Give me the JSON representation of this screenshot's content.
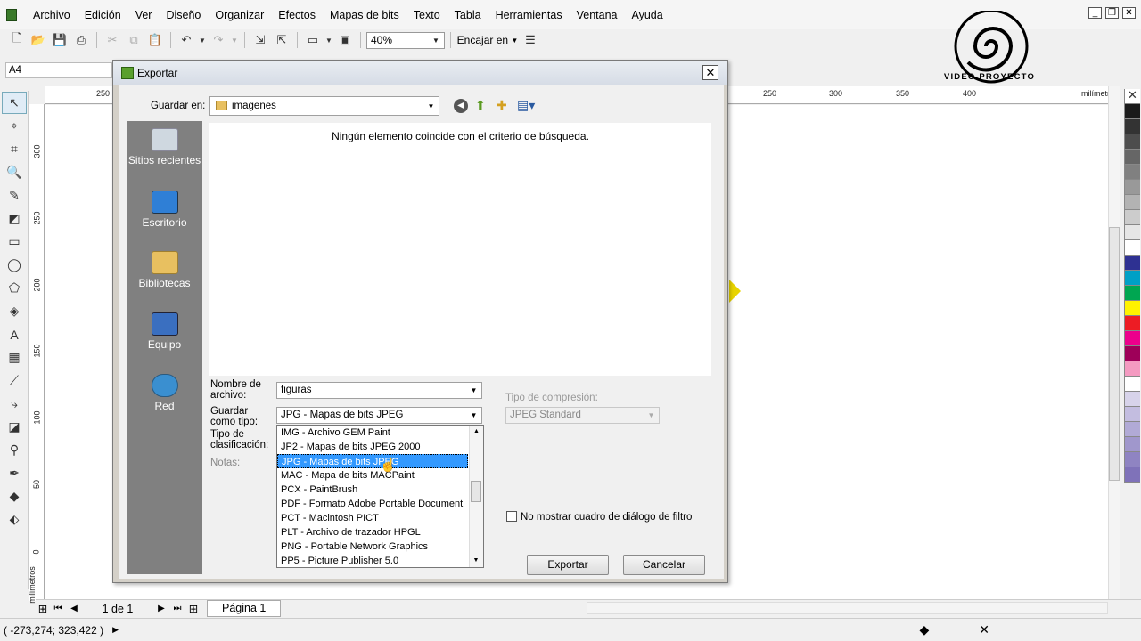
{
  "menu": [
    "Archivo",
    "Edición",
    "Ver",
    "Diseño",
    "Organizar",
    "Efectos",
    "Mapas de bits",
    "Texto",
    "Tabla",
    "Herramientas",
    "Ventana",
    "Ayuda"
  ],
  "toolbar": {
    "zoom": "40%",
    "snap": "Encajar en"
  },
  "property_bar": {
    "page_size": "A4"
  },
  "rulers": {
    "top": [
      "250",
      "250",
      "300",
      "350",
      "400"
    ],
    "top_unit": "milímetros",
    "left": [
      "300",
      "250",
      "200",
      "150",
      "100",
      "50",
      "0"
    ],
    "left_unit": "milímetros"
  },
  "logo": {
    "text": "Video Proyecto"
  },
  "palette": [
    "none",
    "#1a1a1a",
    "#333333",
    "#4d4d4d",
    "#666666",
    "#808080",
    "#999999",
    "#b3b3b3",
    "#cccccc",
    "#e6e6e6",
    "#ffffff",
    "#2e3192",
    "#00a0c6",
    "#00a651",
    "#fff200",
    "#ed1c24",
    "#ec008c",
    "#9e0059",
    "#f49ac1",
    "#ffffff",
    "#d7d3ea",
    "#c3bde0",
    "#b1aad6",
    "#a097cc",
    "#8f84c2",
    "#7f72b9"
  ],
  "page_nav": {
    "count": "1 de 1",
    "page_tab": "Página 1"
  },
  "status": {
    "coords": "( -273,274; 323,422 )"
  },
  "dialog": {
    "title": "Exportar",
    "save_in_label": "Guardar en:",
    "save_in_value": "imagenes",
    "places": [
      {
        "label": "Sitios recientes",
        "icon": "recent-places-icon"
      },
      {
        "label": "Escritorio",
        "icon": "desktop-icon"
      },
      {
        "label": "Bibliotecas",
        "icon": "libraries-icon"
      },
      {
        "label": "Equipo",
        "icon": "computer-icon"
      },
      {
        "label": "Red",
        "icon": "network-icon"
      }
    ],
    "empty_message": "Ningún elemento coincide con el criterio de búsqueda.",
    "filename_label": "Nombre de archivo:",
    "filename_value": "figuras",
    "type_label": "Guardar como tipo:",
    "type_value": "JPG - Mapas de bits JPEG",
    "sort_label": "Tipo de clasificación:",
    "notes_label": "Notas:",
    "compression_label": "Tipo de compresión:",
    "compression_value": "JPEG Standard",
    "no_filter_dialog_label": "No mostrar cuadro de diálogo de filtro",
    "type_options": [
      "IMG - Archivo GEM Paint",
      "JP2 - Mapas de bits JPEG 2000",
      "JPG - Mapas de bits JPEG",
      "MAC - Mapa de bits MACPaint",
      "PCX - PaintBrush",
      "PDF - Formato Adobe Portable Document",
      "PCT - Macintosh PICT",
      "PLT - Archivo de trazador HPGL",
      "PNG - Portable Network Graphics",
      "PP5 - Picture Publisher 5.0"
    ],
    "selected_option": "JPG - Mapas de bits JPEG",
    "export_button": "Exportar",
    "cancel_button": "Cancelar"
  }
}
